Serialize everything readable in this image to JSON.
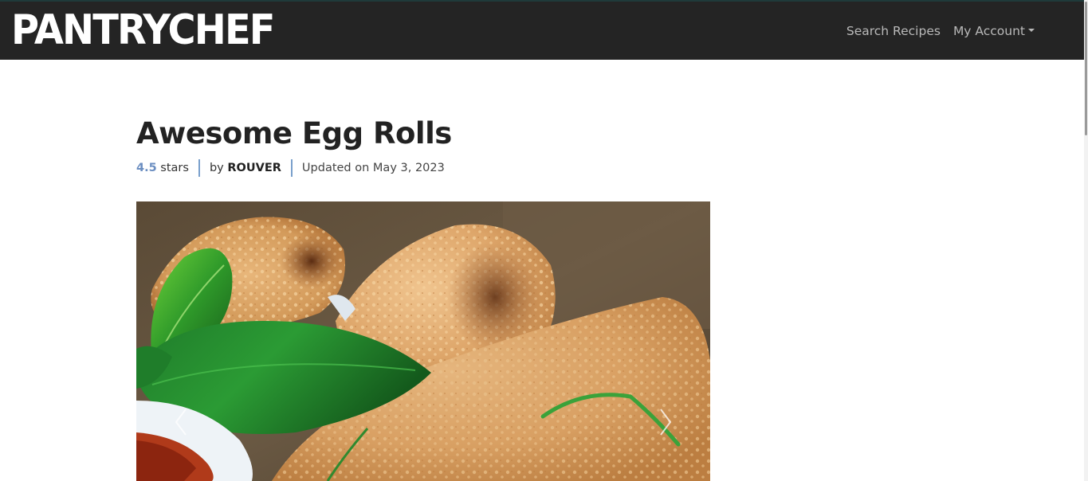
{
  "navbar": {
    "brand": "PANTRYCHEF",
    "links": {
      "search": "Search Recipes",
      "account": "My Account"
    }
  },
  "recipe": {
    "title": "Awesome Egg Rolls",
    "rating_value": "4.5",
    "rating_suffix": " stars",
    "author_prefix": "by ",
    "author": "ROUVER",
    "updated": "Updated on May 3, 2023"
  },
  "carousel": {
    "prev_icon": "chevron-left-icon",
    "next_icon": "chevron-right-icon"
  },
  "colors": {
    "navbar_bg": "#242424",
    "brand_text": "#ffffff",
    "nav_link": "#b9b9b9",
    "rating_accent": "#6b8ec1",
    "separator": "#7aa0cc"
  }
}
